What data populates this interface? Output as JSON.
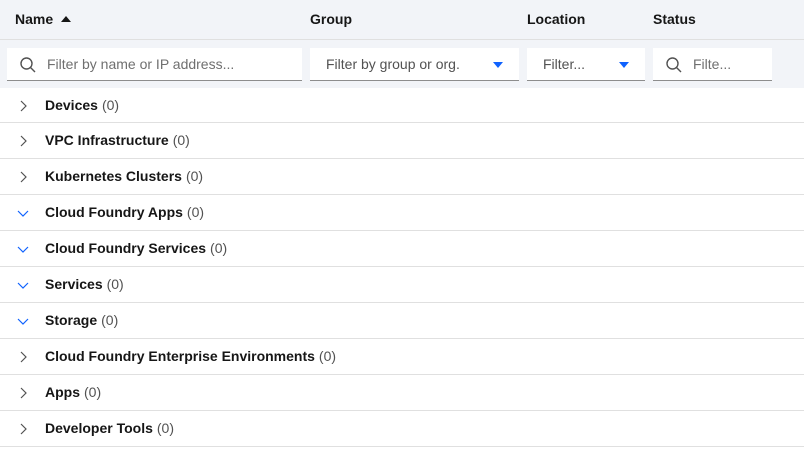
{
  "header": {
    "name": "Name",
    "group": "Group",
    "location": "Location",
    "status": "Status"
  },
  "filters": {
    "name_placeholder": "Filter by name or IP address...",
    "group_placeholder": "Filter by group or org.",
    "location_placeholder": "Filter...",
    "status_placeholder": "Filte..."
  },
  "rows": [
    {
      "name": "Devices",
      "count": "(0)",
      "expanded": false
    },
    {
      "name": "VPC Infrastructure",
      "count": "(0)",
      "expanded": false
    },
    {
      "name": "Kubernetes Clusters",
      "count": "(0)",
      "expanded": false
    },
    {
      "name": "Cloud Foundry Apps",
      "count": "(0)",
      "expanded": true
    },
    {
      "name": "Cloud Foundry Services",
      "count": "(0)",
      "expanded": true
    },
    {
      "name": "Services",
      "count": "(0)",
      "expanded": true
    },
    {
      "name": "Storage",
      "count": "(0)",
      "expanded": true
    },
    {
      "name": "Cloud Foundry Enterprise Environments",
      "count": "(0)",
      "expanded": false
    },
    {
      "name": "Apps",
      "count": "(0)",
      "expanded": false
    },
    {
      "name": "Developer Tools",
      "count": "(0)",
      "expanded": false
    }
  ],
  "colors": {
    "header_bg": "#f2f4f8",
    "accent": "#0f62fe",
    "chevron": "#525252"
  }
}
